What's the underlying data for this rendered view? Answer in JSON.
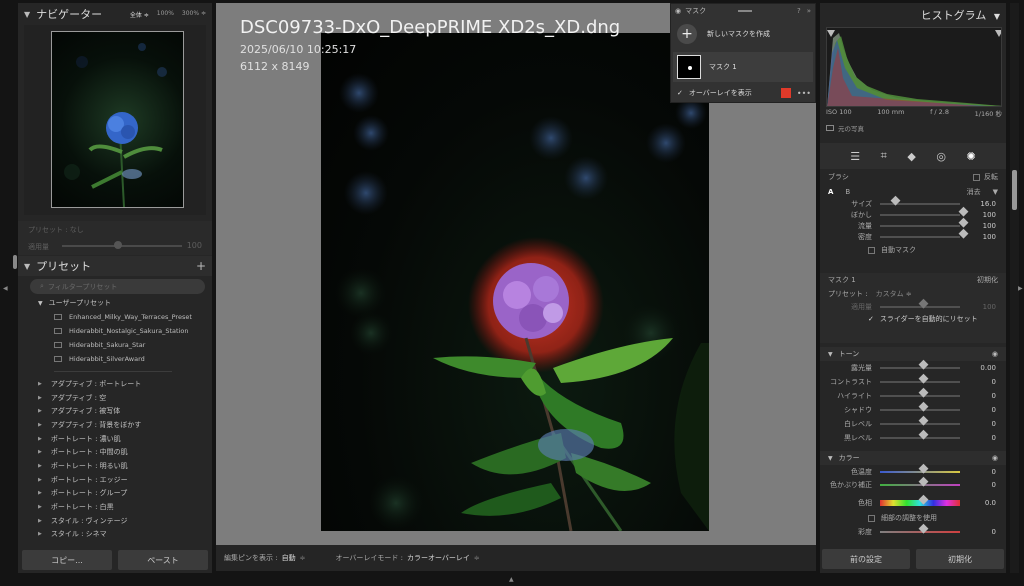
{
  "navigator": {
    "title": "ナビゲーター",
    "zoom_options": [
      "全体 ≑",
      "100%",
      "300% ≑"
    ]
  },
  "preset_amount": {
    "preset_label": "プリセット : なし",
    "amount_label": "適用量",
    "amount_value": "100"
  },
  "presets": {
    "title": "プリセット",
    "filter_placeholder": "フィルタープリセット",
    "user_group": "ユーザープリセット",
    "user_items": [
      "Enhanced_Milky_Way_Terraces_Preset",
      "Hiderabbit_Nostalgic_Sakura_Station",
      "Hiderabbit_Sakura_Star",
      "Hiderabbit_SilverAward"
    ],
    "groups": [
      "アダプティブ : ポートレート",
      "アダプティブ : 空",
      "アダプティブ : 被写体",
      "アダプティブ : 背景をぼかす",
      "ポートレート : 濃い肌",
      "ポートレート : 中間の肌",
      "ポートレート : 明るい肌",
      "ポートレート : エッジー",
      "ポートレート : グループ",
      "ポートレート : 白黒",
      "スタイル : ヴィンテージ",
      "スタイル : シネマ"
    ]
  },
  "left_buttons": {
    "copy": "コピー...",
    "paste": "ペースト"
  },
  "image": {
    "title": "DSC09733-DxO_DeepPRIME XD2s_XD.dng",
    "datetime": "2025/06/10 10:25:17",
    "dimensions": "6112 x 8149"
  },
  "bottom_bar": {
    "edit_pins_label": "編集ピンを表示 :",
    "edit_pins_value": "自動",
    "overlay_mode_label": "オーバーレイモード :",
    "overlay_mode_value": "カラーオーバーレイ"
  },
  "mask_panel": {
    "title": "マスク",
    "new_mask": "新しいマスクを作成",
    "mask_name": "マスク 1",
    "show_overlay": "オーバーレイを表示",
    "overlay_color": "#e03a2a"
  },
  "histogram": {
    "title": "ヒストグラム",
    "iso": "ISO 100",
    "focal": "100 mm",
    "aperture": "f / 2.8",
    "shutter": "1/160 秒",
    "original_photo": "元の写真"
  },
  "brush": {
    "title": "ブラシ",
    "invert": "反転",
    "tab_a": "A",
    "tab_b": "B",
    "erase": "消去",
    "sliders": [
      {
        "label": "サイズ",
        "value": "16.0",
        "level": 0.15
      },
      {
        "label": "ぼかし",
        "value": "100",
        "level": 1.0
      },
      {
        "label": "流量",
        "value": "100",
        "level": 1.0
      },
      {
        "label": "密度",
        "value": "100",
        "level": 1.0
      }
    ],
    "auto_mask": "自動マスク"
  },
  "mask1": {
    "title": "マスク 1",
    "reset": "初期化",
    "preset_label": "プリセット :",
    "preset_value": "カスタム ≑",
    "amount_label": "適用量",
    "amount_value": "100",
    "auto_reset": "スライダーを自動的にリセット"
  },
  "tone": {
    "title": "トーン",
    "sliders": [
      {
        "label": "露光量",
        "value": "0.00"
      },
      {
        "label": "コントラスト",
        "value": "0"
      },
      {
        "label": "ハイライト",
        "value": "0"
      },
      {
        "label": "シャドウ",
        "value": "0"
      },
      {
        "label": "白レベル",
        "value": "0"
      },
      {
        "label": "黒レベル",
        "value": "0"
      }
    ]
  },
  "color": {
    "title": "カラー",
    "sliders": [
      {
        "label": "色温度",
        "value": "0"
      },
      {
        "label": "色かぶり補正",
        "value": "0"
      }
    ],
    "hue_label": "色相",
    "hue_value": "0.0",
    "fine_adjust": "細部の調整を使用",
    "saturation_label": "彩度",
    "saturation_value": "0"
  },
  "right_buttons": {
    "previous": "前の設定",
    "reset": "初期化"
  }
}
